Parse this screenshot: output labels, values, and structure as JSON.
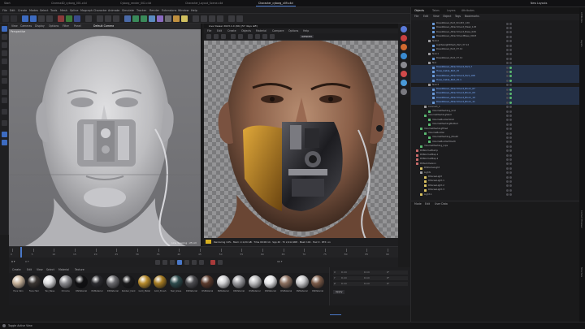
{
  "window": {
    "tabs": [
      "Start",
      "Cinema4D_cyborg_001.c4d",
      "Cyborg_render_002.c4d",
      "Character_Layout_Scene.c4d",
      "Character_cyborg_v09.c4d"
    ],
    "active_tab_index": 4,
    "right_tabs": [
      "Objects",
      "Takes",
      "Layers",
      "Attributes"
    ],
    "right_tabs_active": 0,
    "account": "New Layouts"
  },
  "menubar": [
    "File",
    "Edit",
    "Create",
    "Modes",
    "Select",
    "Tools",
    "Mesh",
    "Spline",
    "Mograph",
    "Character",
    "Animate",
    "Simulate",
    "Tracker",
    "Render",
    "Extensions",
    "Window",
    "Help"
  ],
  "viewport1": {
    "menus": [
      "View",
      "Cameras",
      "Display",
      "Options",
      "Filter",
      "Panel"
    ],
    "label": "Perspective",
    "corner_tag": "Default Camera",
    "footer": "Line Spacing : 25 cm"
  },
  "viewport2": {
    "title": "Live Viewer 2023.1.0 (R4) (57 days left)",
    "menus": [
      "File",
      "Edit",
      "Create",
      "Objects",
      "Material",
      "Compare",
      "Options",
      "Help"
    ],
    "mode": "IRENDER",
    "status": "Rendering 14%  ·  Mem: 2,1/24 GB  ·  Time 00:00:14  ·  Spp 40  ·  Tri 2,412,908  ·  Mesh 104  ·  Hair 0  ·  RTX: on"
  },
  "timeline": {
    "ticks": [
      "0",
      "5",
      "10",
      "15",
      "20",
      "25",
      "30",
      "35",
      "40",
      "45",
      "50",
      "55",
      "60",
      "65",
      "70",
      "75",
      "80",
      "85",
      "90"
    ],
    "current_frame": "0 F",
    "start": "0 F",
    "end": "90 F"
  },
  "materials": {
    "menus": [
      "Create",
      "Edit",
      "View",
      "Select",
      "Material",
      "Texture"
    ],
    "items": [
      {
        "label": "Face Skin",
        "color": "#c7b29a"
      },
      {
        "label": "Face Hair",
        "color": "#3a3532"
      },
      {
        "label": "Tex_Base",
        "color": "#dcdcde"
      },
      {
        "label": "Chrome",
        "color": "#8a8a8e"
      },
      {
        "label": "RSMaterial",
        "color": "#101012"
      },
      {
        "label": "RSMaterial",
        "color": "#2a2a2e"
      },
      {
        "label": "RSMaterial",
        "color": "#6a6a6e"
      },
      {
        "label": "Rubber_Dark",
        "color": "#1a1a1c"
      },
      {
        "label": "Gold_Metal",
        "color": "#b68a2c"
      },
      {
        "label": "Gold_Brush",
        "color": "#a57b22"
      },
      {
        "label": "Teal_Glass",
        "color": "#2d4a4c"
      },
      {
        "label": "RSMaterial",
        "color": "#4c4c50"
      },
      {
        "label": "RSMaterial",
        "color": "#5a3a2c"
      },
      {
        "label": "RSMaterial",
        "color": "#d0d0d2"
      },
      {
        "label": "RSMaterial",
        "color": "#9a9a9e"
      },
      {
        "label": "RSMaterial",
        "color": "#bcbcbe"
      },
      {
        "label": "RSMaterial",
        "color": "#e6e6e8"
      },
      {
        "label": "RSMaterial",
        "color": "#8c7060"
      },
      {
        "label": "RSMaterial",
        "color": "#c9c9cb"
      },
      {
        "label": "RSMaterial",
        "color": "#7a5a48"
      }
    ]
  },
  "attributes": {
    "rows": [
      {
        "axis": "X",
        "pos": "0 cm",
        "size": "0 cm",
        "rot": "0°"
      },
      {
        "axis": "Y",
        "pos": "0 cm",
        "size": "0 cm",
        "rot": "0°"
      },
      {
        "axis": "Z",
        "pos": "0 cm",
        "size": "0 cm",
        "rot": "0°"
      }
    ],
    "apply_label": "Apply"
  },
  "object_manager": {
    "menus": [
      "File",
      "Edit",
      "View",
      "Object",
      "Tags",
      "Bookmarks"
    ],
    "rows": [
      {
        "depth": 4,
        "name": "RoseWeave_Part_ShoPrd_120",
        "color": "#6a9ad8",
        "sel": false
      },
      {
        "depth": 4,
        "name": "RoseWeave_Attachment_Mask_125",
        "color": "#6a9ad8",
        "sel": false
      },
      {
        "depth": 4,
        "name": "RoseWeave_Attachment_Base_026",
        "color": "#6a9ad8",
        "sel": false
      },
      {
        "depth": 4,
        "name": "RoseWeave_AttachmentBase_0023",
        "color": "#6a9ad8",
        "sel": false
      },
      {
        "depth": 3,
        "name": "Null.2",
        "color": "#9a9a9e",
        "sel": false
      },
      {
        "depth": 4,
        "name": "LightweightMesh_Part_37.12",
        "color": "#6a9ad8",
        "sel": false
      },
      {
        "depth": 4,
        "name": "RoseWeave_Part_37.12",
        "color": "#6a9ad8",
        "sel": false
      },
      {
        "depth": 3,
        "name": "Null.1",
        "color": "#9a9a9e",
        "sel": false
      },
      {
        "depth": 4,
        "name": "RoseWeave_Part_37.11",
        "color": "#6a9ad8",
        "sel": false
      },
      {
        "depth": 3,
        "name": "Null",
        "color": "#9a9a9e",
        "sel": false
      },
      {
        "depth": 4,
        "name": "RoseWeave_Attachment_Part_7",
        "color": "#6a9ad8",
        "sel": true
      },
      {
        "depth": 4,
        "name": "Hose_Cable_Part_15",
        "color": "#6a9ad8",
        "sel": true
      },
      {
        "depth": 4,
        "name": "RoseWeave_Attachment_Part_198",
        "color": "#6a9ad8",
        "sel": true
      },
      {
        "depth": 4,
        "name": "Hose_Cable_Part_15.1",
        "color": "#6a9ad8",
        "sel": true
      },
      {
        "depth": 3,
        "name": "Null.3",
        "color": "#9a9a9e",
        "sel": false
      },
      {
        "depth": 4,
        "name": "RoseWeave_Attachment_Block_07",
        "color": "#6a9ad8",
        "sel": true
      },
      {
        "depth": 4,
        "name": "RoseWeave_Attachment_Block_09",
        "color": "#6a9ad8",
        "sel": true
      },
      {
        "depth": 4,
        "name": "RoseWeave_Attachment_Block_10",
        "color": "#6a9ad8",
        "sel": true
      },
      {
        "depth": 4,
        "name": "RoseWeave_Attachment_Block_11",
        "color": "#6a9ad8",
        "sel": true
      },
      {
        "depth": 2,
        "name": "Connect_1",
        "color": "#9a9a9e",
        "sel": false
      },
      {
        "depth": 3,
        "name": "VolumeMeshing_Grid",
        "color": "#5ab870",
        "sel": false
      },
      {
        "depth": 2,
        "name": "VolumeMeshingSkull",
        "color": "#5ab870",
        "sel": false
      },
      {
        "depth": 3,
        "name": "VolumeBuilderSkull",
        "color": "#5ab870",
        "sel": false
      },
      {
        "depth": 3,
        "name": "VolumeMeshingBottom",
        "color": "#5ab870",
        "sel": false
      },
      {
        "depth": 1,
        "name": "VolumeMeshingFilled",
        "color": "#5ab870",
        "sel": false
      },
      {
        "depth": 2,
        "name": "VolumeBuilder",
        "color": "#5ab870",
        "sel": false
      },
      {
        "depth": 3,
        "name": "VolumeMeshing_Mouth",
        "color": "#5ab870",
        "sel": false
      },
      {
        "depth": 3,
        "name": "VolumeBuilderMouth",
        "color": "#5ab870",
        "sel": false
      },
      {
        "depth": 1,
        "name": "VolumeMeshing_Lips",
        "color": "#5ab870",
        "sel": false
      },
      {
        "depth": 0,
        "name": "RSNormalBump",
        "color": "#c86a6a",
        "sel": false
      },
      {
        "depth": 0,
        "name": "RSNormalMap.1",
        "color": "#c86a6a",
        "sel": false
      },
      {
        "depth": 0,
        "name": "RSNormalMap.2",
        "color": "#c86a6a",
        "sel": false
      },
      {
        "depth": 0,
        "name": "RSSubdivision",
        "color": "#c86a6a",
        "sel": false
      },
      {
        "depth": 1,
        "name": "RSDomeLight",
        "color": "#d8c060",
        "sel": false
      },
      {
        "depth": 1,
        "name": "Lights",
        "color": "#9a9a9e",
        "sel": false
      },
      {
        "depth": 2,
        "name": "RSAreaLight",
        "color": "#d8c060",
        "sel": false
      },
      {
        "depth": 2,
        "name": "RSAreaLight.1",
        "color": "#d8c060",
        "sel": false
      },
      {
        "depth": 2,
        "name": "RSAreaLight.2",
        "color": "#d8c060",
        "sel": false
      },
      {
        "depth": 2,
        "name": "RSAreaLight.3",
        "color": "#d8c060",
        "sel": false
      },
      {
        "depth": 1,
        "name": "Light.1",
        "color": "#d8c060",
        "sel": false
      }
    ],
    "lower_menus": [
      "Mode",
      "Edit",
      "User Data"
    ]
  },
  "statusbar": {
    "hint": "Toggle Active View"
  },
  "side_labels": [
    "Attributes",
    "Layers",
    "Content Browser",
    "Structure"
  ]
}
